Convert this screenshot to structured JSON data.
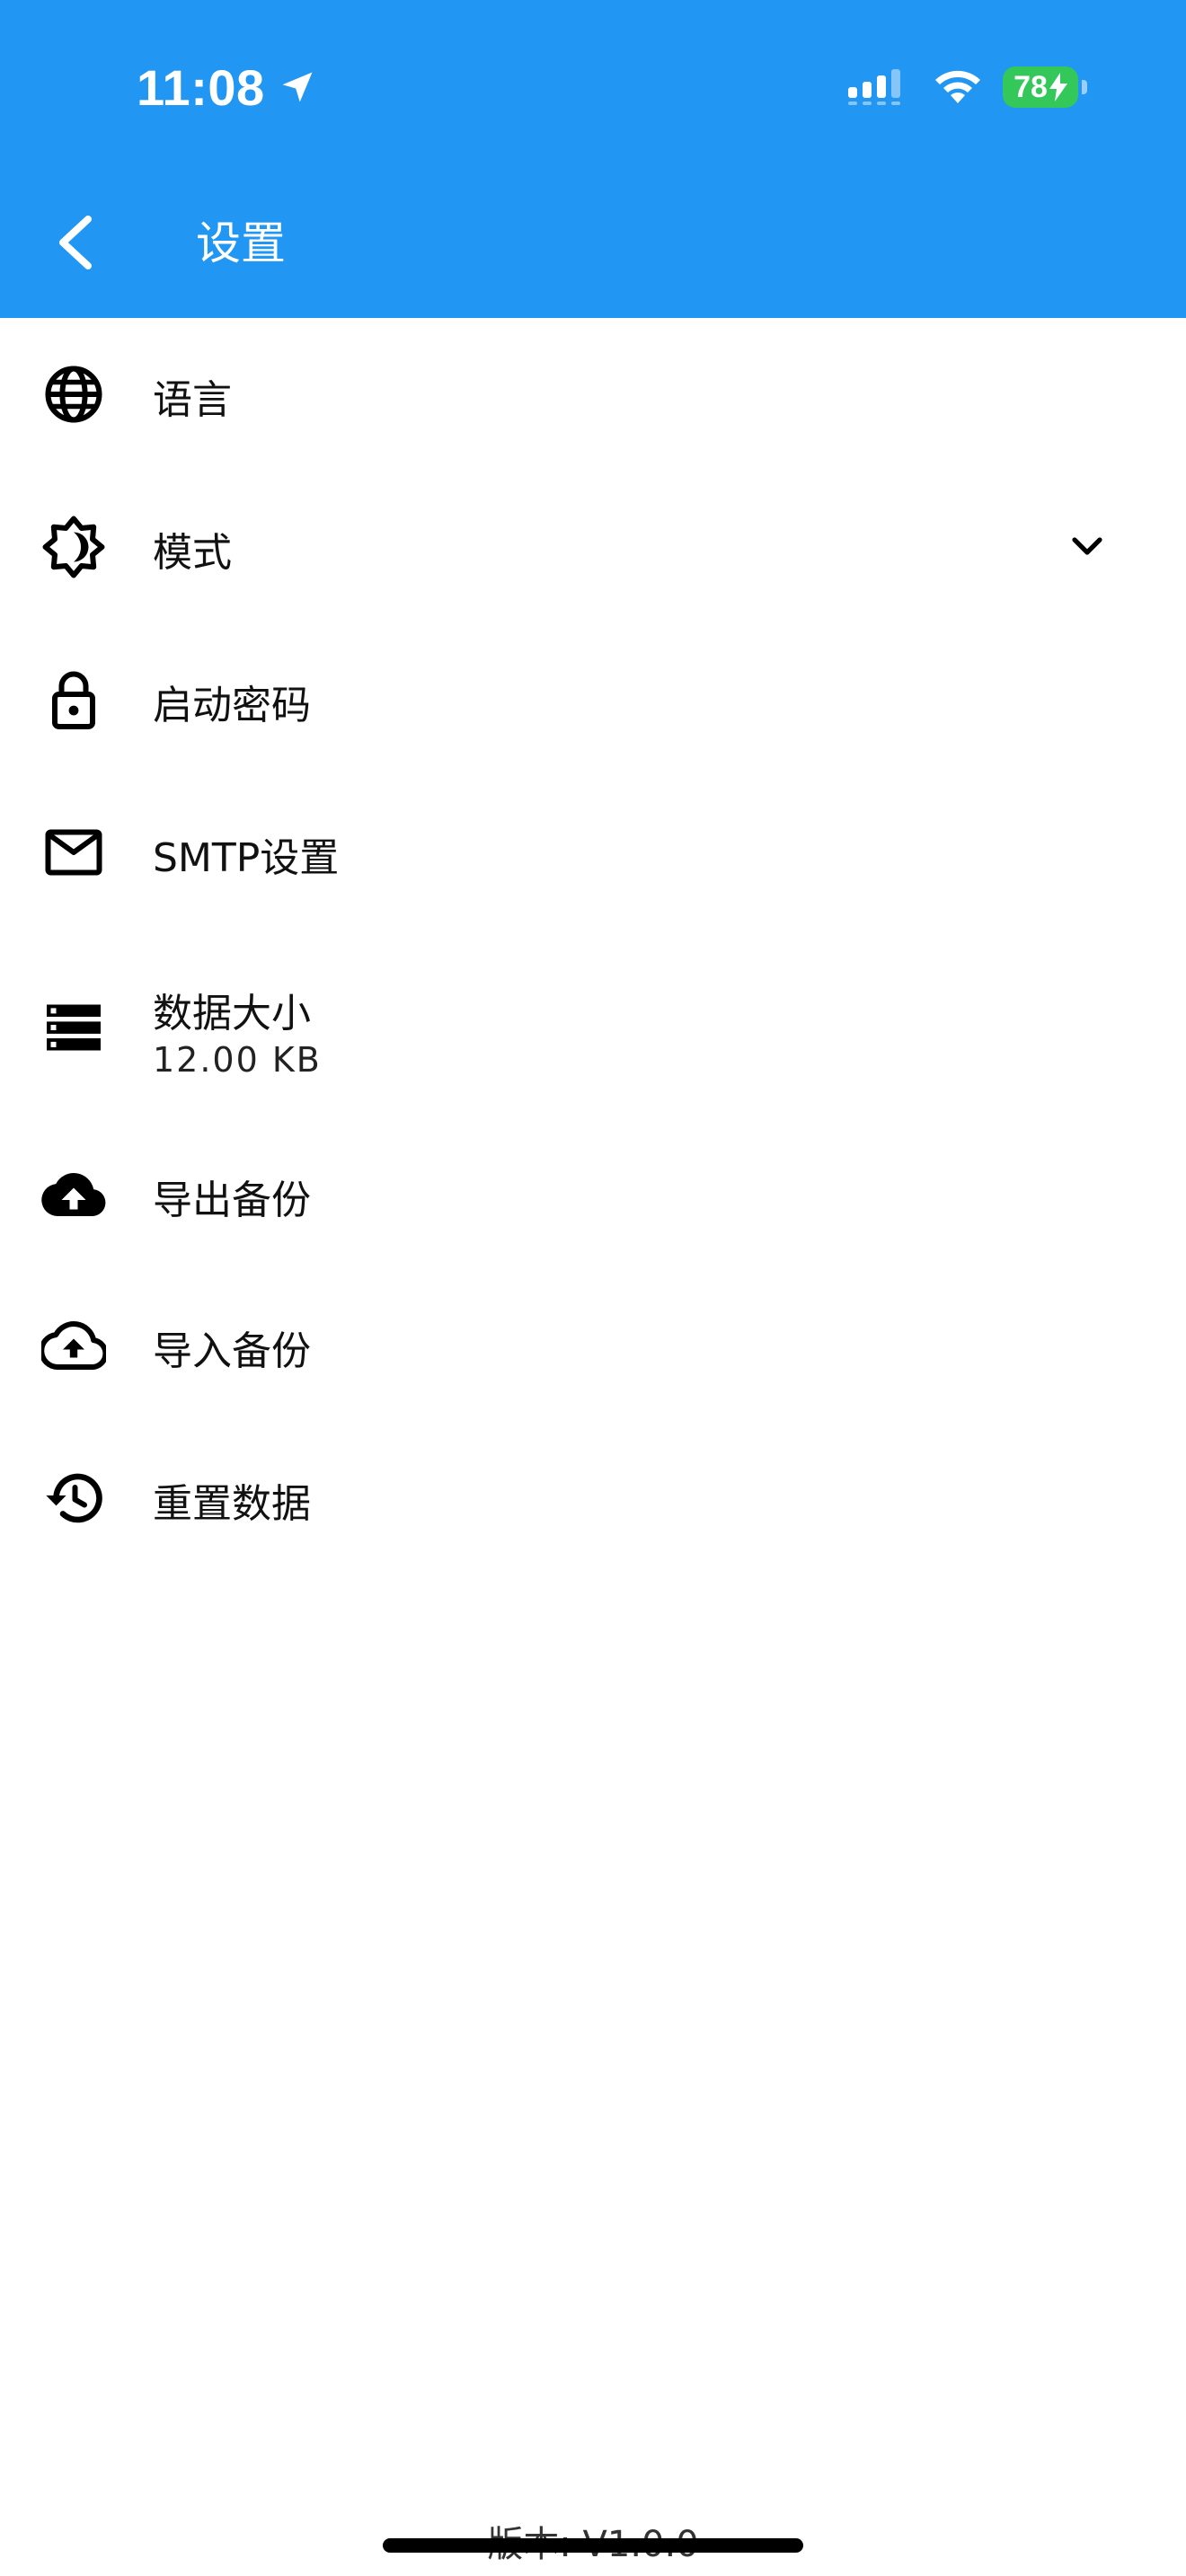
{
  "status_bar": {
    "time": "11:08",
    "battery_percent": "78",
    "icons": [
      "location-arrow-icon",
      "cellular-signal-icon",
      "wifi-icon",
      "battery-charging-icon"
    ]
  },
  "app_bar": {
    "title": "设置",
    "back_icon": "chevron-left-icon",
    "background_color": "#2196F3"
  },
  "settings": [
    {
      "label": "语言",
      "icon": "globe-icon"
    },
    {
      "label": "模式",
      "icon": "brightness-mode-icon",
      "trailing_icon": "chevron-down-icon"
    },
    {
      "label": "启动密码",
      "icon": "lock-icon"
    },
    {
      "label": "SMTP设置",
      "icon": "mail-icon"
    },
    {
      "label": "数据大小",
      "sublabel": "12.00 KB",
      "icon": "storage-icon"
    },
    {
      "label": "导出备份",
      "icon": "cloud-upload-filled-icon"
    },
    {
      "label": "导入备份",
      "icon": "cloud-upload-outline-icon"
    },
    {
      "label": "重置数据",
      "icon": "history-restore-icon"
    }
  ],
  "footer": {
    "version": "版本: V1.0.0"
  }
}
